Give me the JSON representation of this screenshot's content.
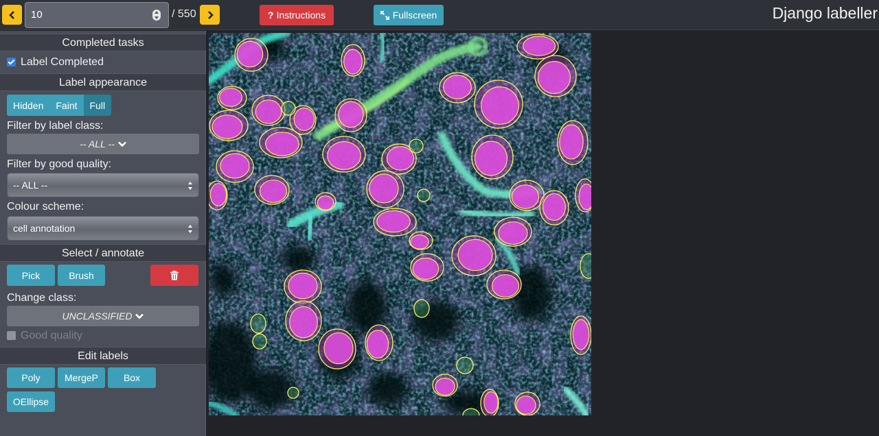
{
  "topbar": {
    "page_value": "10",
    "page_total": "/ 550",
    "instructions_label": "Instructions",
    "fullscreen_label": "Fullscreen",
    "app_title": "Django labeller"
  },
  "sidebar": {
    "completed_tasks_header": "Completed tasks",
    "label_completed": "Label Completed",
    "label_appearance_header": "Label appearance",
    "appearance_buttons": [
      "Hidden",
      "Faint",
      "Full"
    ],
    "filter_class_label": "Filter by label class:",
    "filter_class_value": "-- ALL --",
    "filter_quality_label": "Filter by good quality:",
    "filter_quality_value": "-- ALL --",
    "colour_scheme_label": "Colour scheme:",
    "colour_scheme_value": "cell annotation",
    "select_annotate_header": "Select / annotate",
    "pick_label": "Pick",
    "brush_label": "Brush",
    "change_class_label": "Change class:",
    "change_class_value": "UNCLASSIFIED",
    "good_quality_label": "Good quality",
    "edit_labels_header": "Edit labels",
    "edit_buttons": [
      "Poly",
      "MergeP",
      "Box",
      "OEllipse"
    ]
  },
  "colors": {
    "accent_teal": "#3ea0b8",
    "danger_red": "#d63a41",
    "nav_yellow": "#f5c01b",
    "label_outline": "#ffef5a",
    "cell_fill": "#d44ad4"
  }
}
